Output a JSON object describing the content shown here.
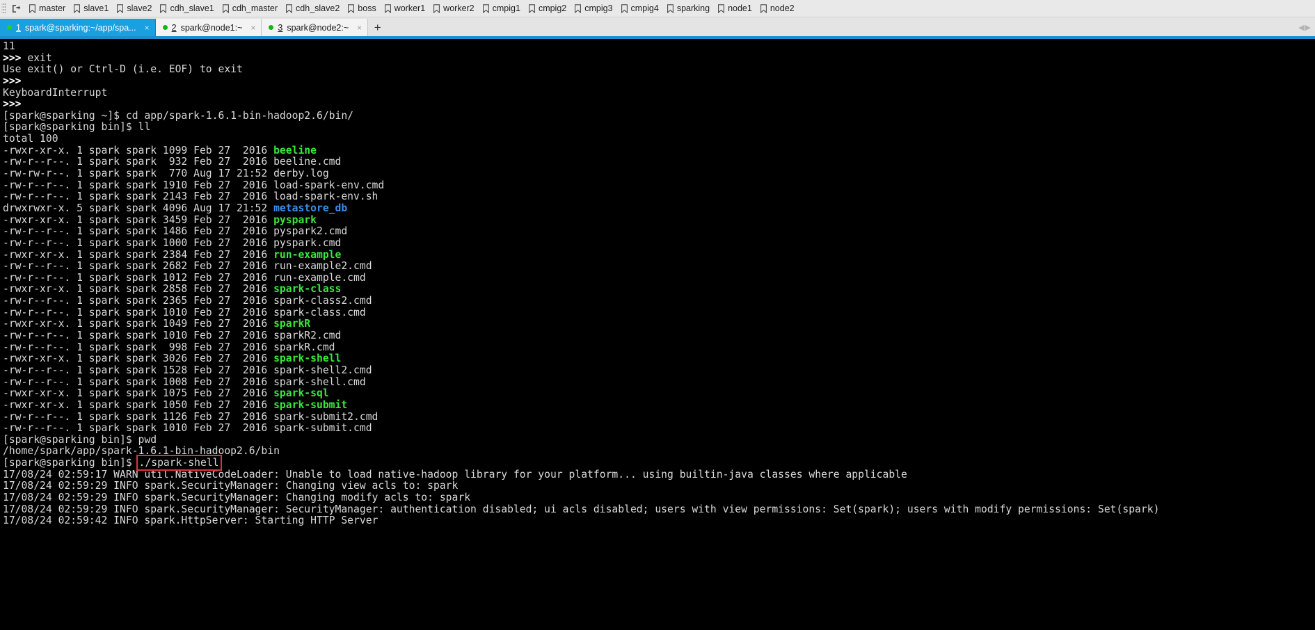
{
  "bookmarks": {
    "grip_icon": "drag-grip",
    "first_icon": "open-session-icon",
    "items": [
      {
        "icon": "bookmark-icon",
        "label": "master"
      },
      {
        "icon": "bookmark-icon",
        "label": "slave1"
      },
      {
        "icon": "bookmark-icon",
        "label": "slave2"
      },
      {
        "icon": "bookmark-icon",
        "label": "cdh_slave1"
      },
      {
        "icon": "bookmark-icon",
        "label": "cdh_master"
      },
      {
        "icon": "bookmark-icon",
        "label": "cdh_slave2"
      },
      {
        "icon": "bookmark-icon",
        "label": "boss"
      },
      {
        "icon": "bookmark-icon",
        "label": "worker1"
      },
      {
        "icon": "bookmark-icon",
        "label": "worker2"
      },
      {
        "icon": "bookmark-icon",
        "label": "cmpig1"
      },
      {
        "icon": "bookmark-icon",
        "label": "cmpig2"
      },
      {
        "icon": "bookmark-icon",
        "label": "cmpig3"
      },
      {
        "icon": "bookmark-icon",
        "label": "cmpig4"
      },
      {
        "icon": "bookmark-icon",
        "label": "sparking"
      },
      {
        "icon": "bookmark-icon",
        "label": "node1"
      },
      {
        "icon": "bookmark-icon",
        "label": "node2"
      }
    ]
  },
  "tabs": {
    "items": [
      {
        "num": "1",
        "title": "spark@sparking:~/app/spa...",
        "active": true,
        "close_label": "×"
      },
      {
        "num": "2",
        "title": "spark@node1:~",
        "active": false,
        "close_label": "×"
      },
      {
        "num": "3",
        "title": "spark@node2:~",
        "active": false,
        "close_label": "×"
      }
    ],
    "add_label": "+",
    "nav_prev": "◀",
    "nav_next": "▶",
    "active_color": "#1a9fe0"
  },
  "terminal": {
    "colors": {
      "background": "#000000",
      "foreground": "#d9d9d9",
      "executable": "#3ae83a",
      "directory": "#3a8ee8",
      "highlight_box": "#e2323c"
    },
    "lines": [
      {
        "segs": [
          {
            "t": "11"
          }
        ]
      },
      {
        "segs": [
          {
            "t": ">>> ",
            "c": "bold-w"
          },
          {
            "t": "exit"
          }
        ]
      },
      {
        "segs": [
          {
            "t": "Use exit() or Ctrl-D (i.e. EOF) to exit"
          }
        ]
      },
      {
        "segs": [
          {
            "t": ">>>",
            "c": "bold-w"
          }
        ]
      },
      {
        "segs": [
          {
            "t": "KeyboardInterrupt"
          }
        ]
      },
      {
        "segs": [
          {
            "t": ">>>",
            "c": "bold-w"
          }
        ]
      },
      {
        "segs": [
          {
            "t": "[spark@sparking ~]$ cd app/spark-1.6.1-bin-hadoop2.6/bin/"
          }
        ]
      },
      {
        "segs": [
          {
            "t": "[spark@sparking bin]$ ll"
          }
        ]
      },
      {
        "segs": [
          {
            "t": "total 100"
          }
        ]
      },
      {
        "segs": [
          {
            "t": "-rwxr-xr-x. 1 spark spark 1099 Feb 27  2016 "
          },
          {
            "t": "beeline",
            "c": "g"
          }
        ]
      },
      {
        "segs": [
          {
            "t": "-rw-r--r--. 1 spark spark  932 Feb 27  2016 beeline.cmd"
          }
        ]
      },
      {
        "segs": [
          {
            "t": "-rw-rw-r--. 1 spark spark  770 Aug 17 21:52 derby.log"
          }
        ]
      },
      {
        "segs": [
          {
            "t": "-rw-r--r--. 1 spark spark 1910 Feb 27  2016 load-spark-env.cmd"
          }
        ]
      },
      {
        "segs": [
          {
            "t": "-rw-r--r--. 1 spark spark 2143 Feb 27  2016 load-spark-env.sh"
          }
        ]
      },
      {
        "segs": [
          {
            "t": "drwxrwxr-x. 5 spark spark 4096 Aug 17 21:52 "
          },
          {
            "t": "metastore_db",
            "c": "b"
          }
        ]
      },
      {
        "segs": [
          {
            "t": "-rwxr-xr-x. 1 spark spark 3459 Feb 27  2016 "
          },
          {
            "t": "pyspark",
            "c": "g"
          }
        ]
      },
      {
        "segs": [
          {
            "t": "-rw-r--r--. 1 spark spark 1486 Feb 27  2016 pyspark2.cmd"
          }
        ]
      },
      {
        "segs": [
          {
            "t": "-rw-r--r--. 1 spark spark 1000 Feb 27  2016 pyspark.cmd"
          }
        ]
      },
      {
        "segs": [
          {
            "t": "-rwxr-xr-x. 1 spark spark 2384 Feb 27  2016 "
          },
          {
            "t": "run-example",
            "c": "g"
          }
        ]
      },
      {
        "segs": [
          {
            "t": "-rw-r--r--. 1 spark spark 2682 Feb 27  2016 run-example2.cmd"
          }
        ]
      },
      {
        "segs": [
          {
            "t": "-rw-r--r--. 1 spark spark 1012 Feb 27  2016 run-example.cmd"
          }
        ]
      },
      {
        "segs": [
          {
            "t": "-rwxr-xr-x. 1 spark spark 2858 Feb 27  2016 "
          },
          {
            "t": "spark-class",
            "c": "g"
          }
        ]
      },
      {
        "segs": [
          {
            "t": "-rw-r--r--. 1 spark spark 2365 Feb 27  2016 spark-class2.cmd"
          }
        ]
      },
      {
        "segs": [
          {
            "t": "-rw-r--r--. 1 spark spark 1010 Feb 27  2016 spark-class.cmd"
          }
        ]
      },
      {
        "segs": [
          {
            "t": "-rwxr-xr-x. 1 spark spark 1049 Feb 27  2016 "
          },
          {
            "t": "sparkR",
            "c": "g"
          }
        ]
      },
      {
        "segs": [
          {
            "t": "-rw-r--r--. 1 spark spark 1010 Feb 27  2016 sparkR2.cmd"
          }
        ]
      },
      {
        "segs": [
          {
            "t": "-rw-r--r--. 1 spark spark  998 Feb 27  2016 sparkR.cmd"
          }
        ]
      },
      {
        "segs": [
          {
            "t": "-rwxr-xr-x. 1 spark spark 3026 Feb 27  2016 "
          },
          {
            "t": "spark-shell",
            "c": "g"
          }
        ]
      },
      {
        "segs": [
          {
            "t": "-rw-r--r--. 1 spark spark 1528 Feb 27  2016 spark-shell2.cmd"
          }
        ]
      },
      {
        "segs": [
          {
            "t": "-rw-r--r--. 1 spark spark 1008 Feb 27  2016 spark-shell.cmd"
          }
        ]
      },
      {
        "segs": [
          {
            "t": "-rwxr-xr-x. 1 spark spark 1075 Feb 27  2016 "
          },
          {
            "t": "spark-sql",
            "c": "g"
          }
        ]
      },
      {
        "segs": [
          {
            "t": "-rwxr-xr-x. 1 spark spark 1050 Feb 27  2016 "
          },
          {
            "t": "spark-submit",
            "c": "g"
          }
        ]
      },
      {
        "segs": [
          {
            "t": "-rw-r--r--. 1 spark spark 1126 Feb 27  2016 spark-submit2.cmd"
          }
        ]
      },
      {
        "segs": [
          {
            "t": "-rw-r--r--. 1 spark spark 1010 Feb 27  2016 spark-submit.cmd"
          }
        ]
      },
      {
        "segs": [
          {
            "t": "[spark@sparking bin]$ pwd"
          }
        ]
      },
      {
        "segs": [
          {
            "t": "/home/spark/app/spark-1.6.1-bin-hadoop2.6/bin"
          }
        ]
      },
      {
        "segs": [
          {
            "t": "[spark@sparking bin]$ "
          },
          {
            "t": "./spark-shell",
            "c": "boxed"
          }
        ]
      },
      {
        "segs": [
          {
            "t": "17/08/24 02:59:17 WARN util.NativeCodeLoader: Unable to load native-hadoop library for your platform... using builtin-java classes where applicable"
          }
        ]
      },
      {
        "segs": [
          {
            "t": "17/08/24 02:59:29 INFO spark.SecurityManager: Changing view acls to: spark"
          }
        ]
      },
      {
        "segs": [
          {
            "t": "17/08/24 02:59:29 INFO spark.SecurityManager: Changing modify acls to: spark"
          }
        ]
      },
      {
        "segs": [
          {
            "t": "17/08/24 02:59:29 INFO spark.SecurityManager: SecurityManager: authentication disabled; ui acls disabled; users with view permissions: Set(spark); users with modify permissions: Set(spark)"
          }
        ]
      },
      {
        "segs": [
          {
            "t": "17/08/24 02:59:42 INFO spark.HttpServer: Starting HTTP Server"
          }
        ]
      }
    ]
  }
}
